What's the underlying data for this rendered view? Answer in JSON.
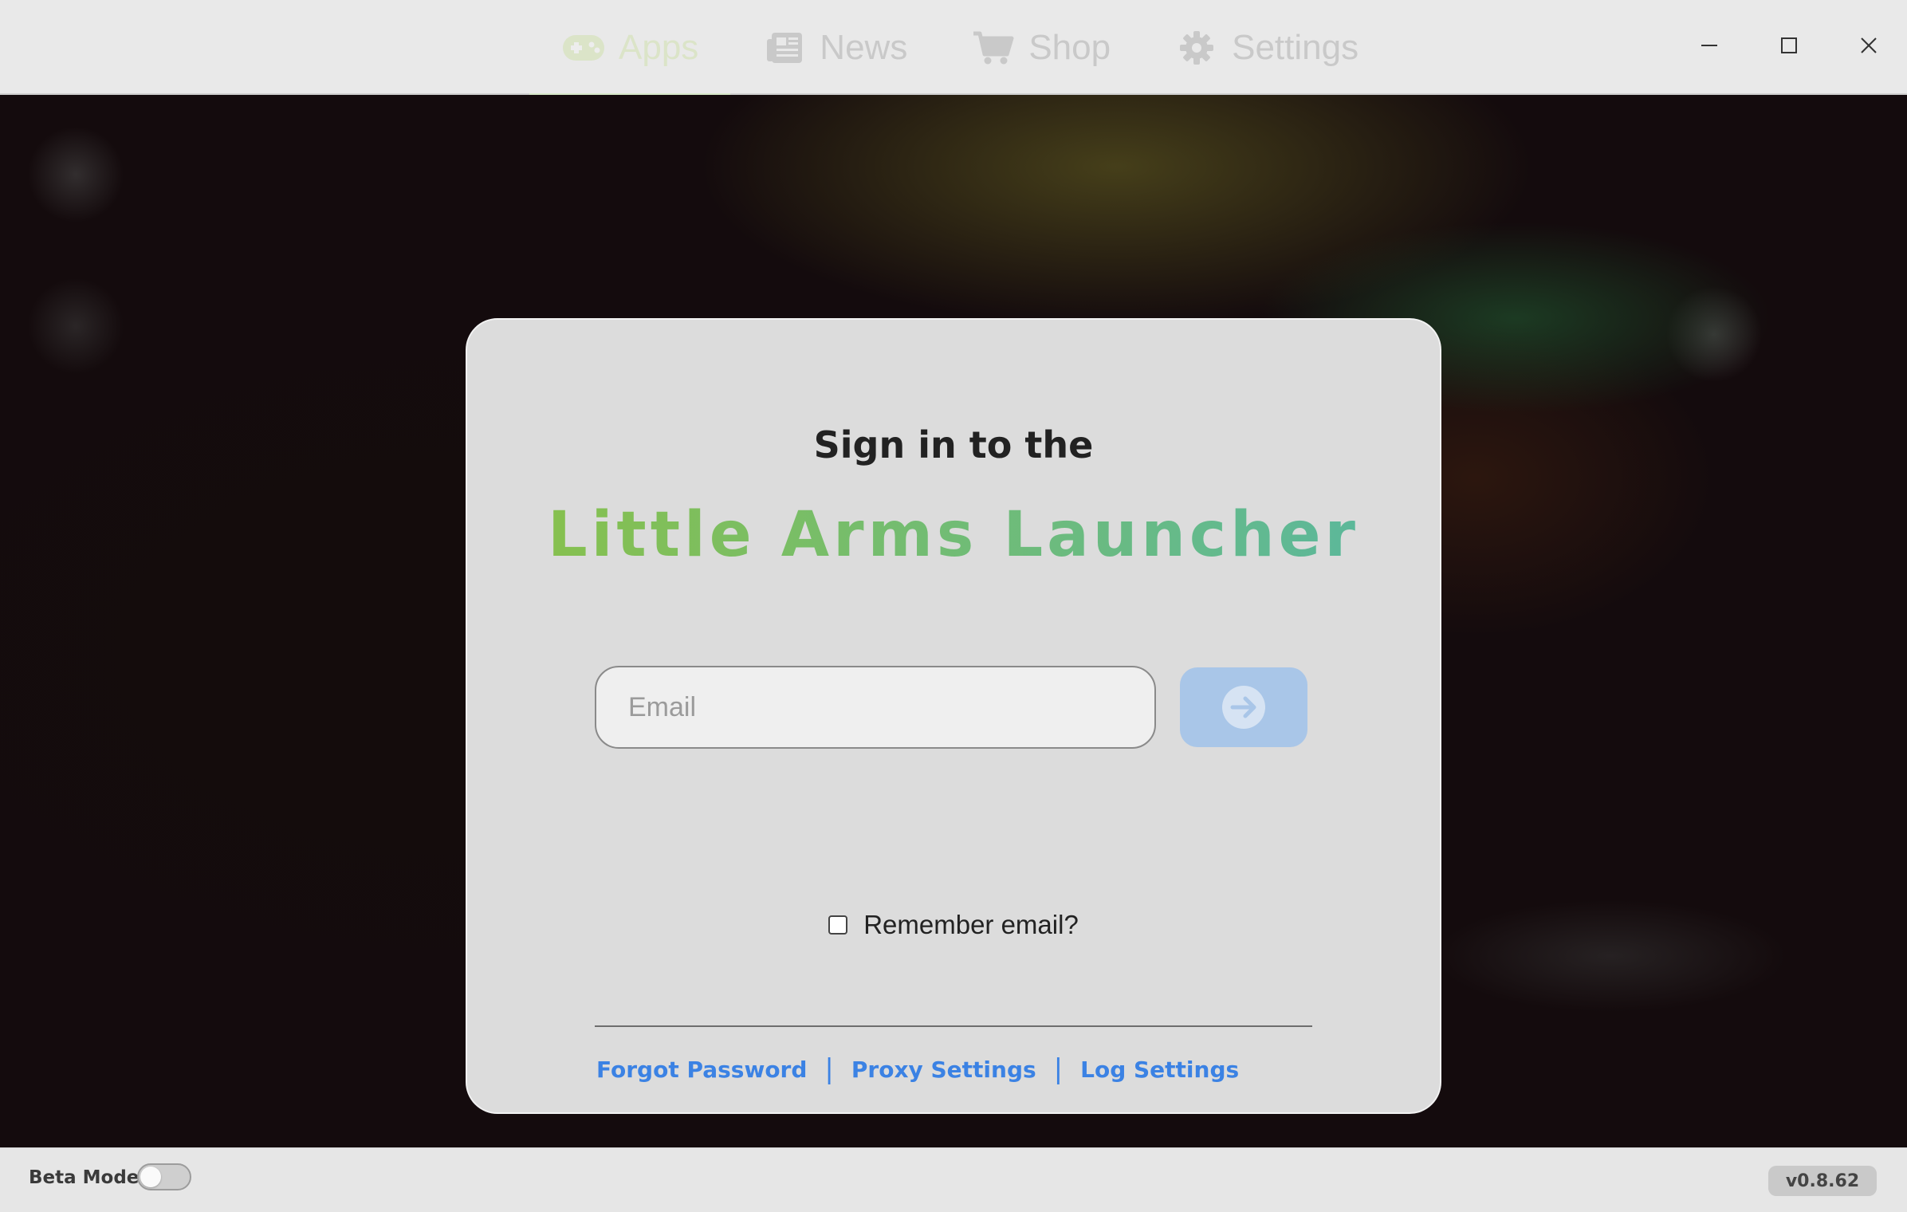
{
  "nav": {
    "items": [
      {
        "label": "Apps",
        "icon": "gamepad-icon",
        "active": true
      },
      {
        "label": "News",
        "icon": "newspaper-icon",
        "active": false
      },
      {
        "label": "Shop",
        "icon": "shopping-cart-icon",
        "active": false
      },
      {
        "label": "Settings",
        "icon": "gear-icon",
        "active": false
      }
    ]
  },
  "window_controls": [
    "minimize-icon",
    "maximize-icon",
    "close-icon"
  ],
  "login": {
    "subtitle": "Sign in to the",
    "title": "Little Arms Launcher",
    "email_placeholder": "Email",
    "email_value": "",
    "submit_icon": "arrow-right-icon",
    "remember_label": "Remember email?",
    "remember_checked": false,
    "links": [
      "Forgot Password",
      "Proxy Settings",
      "Log Settings"
    ],
    "link_separator": "|"
  },
  "footer": {
    "beta_label": "Beta Mode",
    "beta_enabled": false,
    "version": "v0.8.62"
  },
  "colors": {
    "title_gradient_start": "#86c04f",
    "title_gradient_end": "#5cb89a",
    "link": "#3b82e4",
    "submit_button": "#a9c6e8"
  }
}
